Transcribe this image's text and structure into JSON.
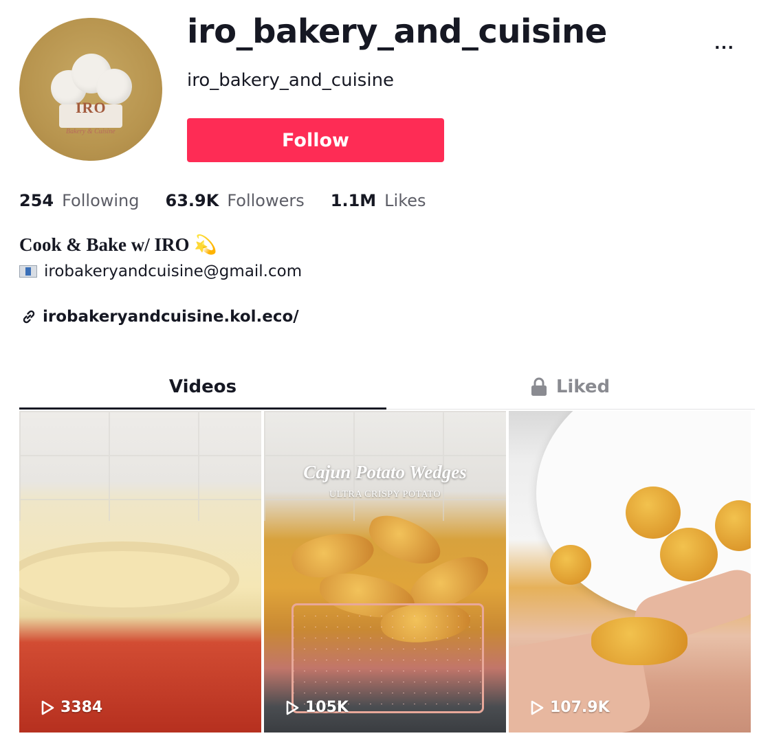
{
  "profile": {
    "title": "iro_bakery_and_cuisine",
    "subtitle": "iro_bakery_and_cuisine",
    "avatar_logo_text": "IRO",
    "avatar_sub_text": "Bakery & Cuisine",
    "more_label": "...",
    "follow_label": "Follow",
    "follow_color": "#fe2c55"
  },
  "stats": [
    {
      "value": "254",
      "label": "Following"
    },
    {
      "value": "63.9K",
      "label": "Followers"
    },
    {
      "value": "1.1M",
      "label": "Likes"
    }
  ],
  "bio": {
    "line1": "Cook & Bake w/ IRO 💫",
    "email": "irobakeryandcuisine@gmail.com",
    "email_icon": "envelope-icon",
    "link": "irobakeryandcuisine.kol.eco/",
    "link_icon": "link-icon"
  },
  "tabs": [
    {
      "label": "Videos",
      "active": true
    },
    {
      "label": "Liked",
      "active": false,
      "icon": "lock-icon"
    }
  ],
  "videos": [
    {
      "views": "3384",
      "overlay_title": "",
      "overlay_sub": ""
    },
    {
      "views": "105K",
      "overlay_title": "Cajun Potato Wedges",
      "overlay_sub": "ULTRA CRISPY POTATO"
    },
    {
      "views": "107.9K",
      "overlay_title": "",
      "overlay_sub": ""
    }
  ]
}
